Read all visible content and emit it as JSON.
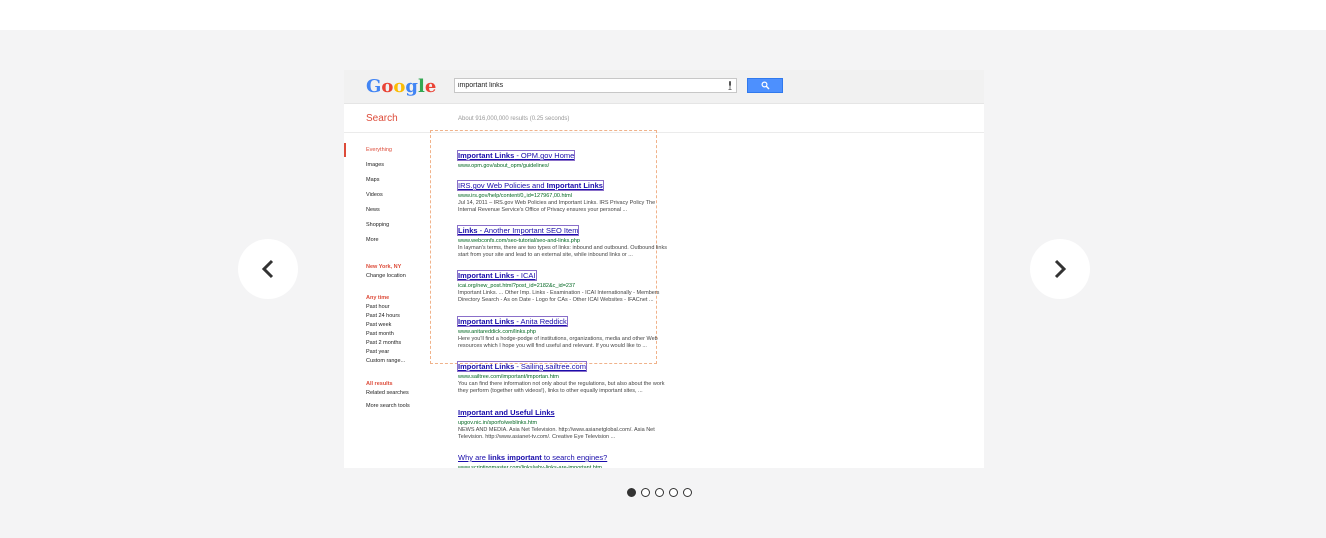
{
  "search": {
    "logo": "Google",
    "query": "important links",
    "label": "Search",
    "result_count": "About 916,000,000 results (0.25 seconds)"
  },
  "sidebar": {
    "types": [
      "Everything",
      "Images",
      "Maps",
      "Videos",
      "News",
      "Shopping",
      "More"
    ],
    "location": "New York, NY",
    "change_location": "Change location",
    "time_header": "Any time",
    "times": [
      "Past hour",
      "Past 24 hours",
      "Past week",
      "Past month",
      "Past 2 months",
      "Past year",
      "Custom range..."
    ],
    "results_header": "All results",
    "related": "Related searches",
    "more_tools": "More search tools"
  },
  "results": [
    {
      "title_pre": "",
      "title_bold": "Important Links",
      "title_post": " - OPM.gov Home",
      "url": "www.opm.gov/about_opm/guidelines/",
      "snippet": []
    },
    {
      "title_pre": "IRS.gov Web Policies and ",
      "title_bold": "Important Links",
      "title_post": "",
      "url": "www.irs.gov/help/content/0,,id=127967,00.html",
      "snippet": [
        "Jul 14, 2011 – IRS.gov Web Policies and Important Links. IRS Privacy Policy The",
        "Internal Revenue Service's Office of Privacy ensures your personal ..."
      ]
    },
    {
      "title_pre": "",
      "title_bold": "Links",
      "title_post": " - Another Important SEO Item",
      "url": "www.webconfs.com/seo-tutorial/seo-and-links.php",
      "snippet": [
        "In layman's terms, there are two types of links: inbound and outbound. Outbound links",
        "start from your site and lead to an external site, while inbound links or ..."
      ]
    },
    {
      "title_pre": "",
      "title_bold": "Important Links",
      "title_post": " - ICAI",
      "url": "icai.org/new_post.html?post_id=2182&c_id=237",
      "snippet": [
        "Important Links. ... Other Imp. Links - Examination - ICAI Internationally - Members",
        "Directory Search - As on Date - Logo for CAs - Other ICAI Websites - IFACnet ..."
      ]
    },
    {
      "title_pre": "",
      "title_bold": "Important Links",
      "title_post": " - Anita Reddick",
      "url": "www.anitareddick.com/links.php",
      "snippet": [
        "Here you'll find a hodge-podge of institutions, organizations, media and other Web",
        "resources which I hope you will find useful and relevant. If you would like to ..."
      ]
    },
    {
      "title_pre": "",
      "title_bold": "Important Links",
      "title_post": " - Sailing.sailtree.com",
      "url": "www.sailtree.com/important/importan.htm",
      "snippet": [
        "You can find there information not only about the regulations, but also about the work",
        "they perform (together with videos!), links to other equally important sites, ..."
      ]
    },
    {
      "title_pre": "",
      "title_bold": "Important and Useful Links",
      "title_post": "",
      "url": "upgov.nic.in/sporfo/weblinks.htm",
      "snippet": [
        "NEWS AND MEDIA. Asia Net Television. http://www.asianetglobal.com/. Asia Net",
        "Television. http://www.asianet-tv.com/. Creative Eye Television ..."
      ]
    },
    {
      "title_pre": "Why are ",
      "title_bold": "links important",
      "title_post": " to search engines?",
      "url": "www.scriptingmaster.com/links/why-links-are-important.htm",
      "snippet": []
    }
  ],
  "carousel": {
    "prev": "chevron-left-icon",
    "next": "chevron-right-icon",
    "dot_count": 5,
    "active_index": 0
  },
  "colors": {
    "accent_red": "#dd4b39",
    "link_blue": "#1a0dab",
    "url_green": "#006621",
    "button_blue": "#4d90fe"
  }
}
